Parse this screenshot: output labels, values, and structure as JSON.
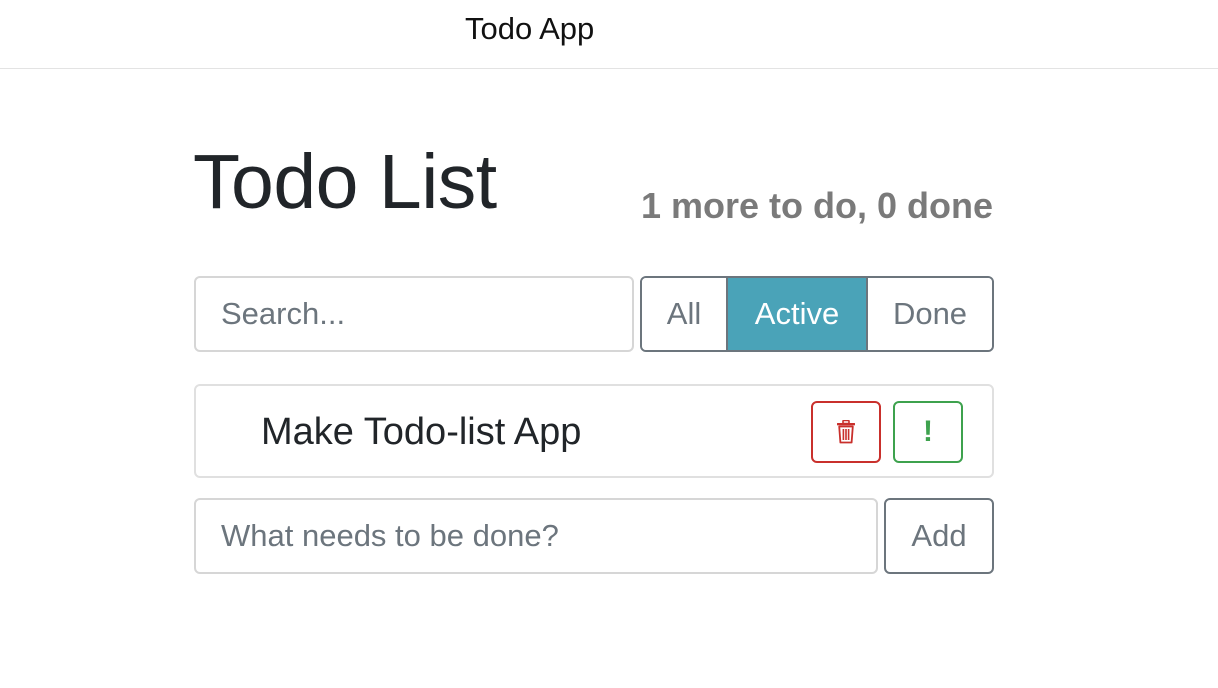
{
  "header": {
    "title": "Todo App"
  },
  "main": {
    "title": "Todo List",
    "counter": "1 more to do, 0 done",
    "search": {
      "value": "",
      "placeholder": "Search..."
    },
    "filters": [
      {
        "label": "All",
        "selected": false
      },
      {
        "label": "Active",
        "selected": true
      },
      {
        "label": "Done",
        "selected": false
      }
    ],
    "todos": [
      {
        "label": "Make Todo-list App",
        "actions": {
          "delete_icon": "trash-icon",
          "important_icon": "exclamation-icon",
          "important_glyph": "!"
        }
      }
    ],
    "new_todo": {
      "value": "",
      "placeholder": "What needs to be done?"
    },
    "add_label": "Add"
  },
  "colors": {
    "active_filter": "#4aa3b8",
    "delete": "#c9302c",
    "important": "#3ea24e",
    "muted": "#6c757d"
  }
}
